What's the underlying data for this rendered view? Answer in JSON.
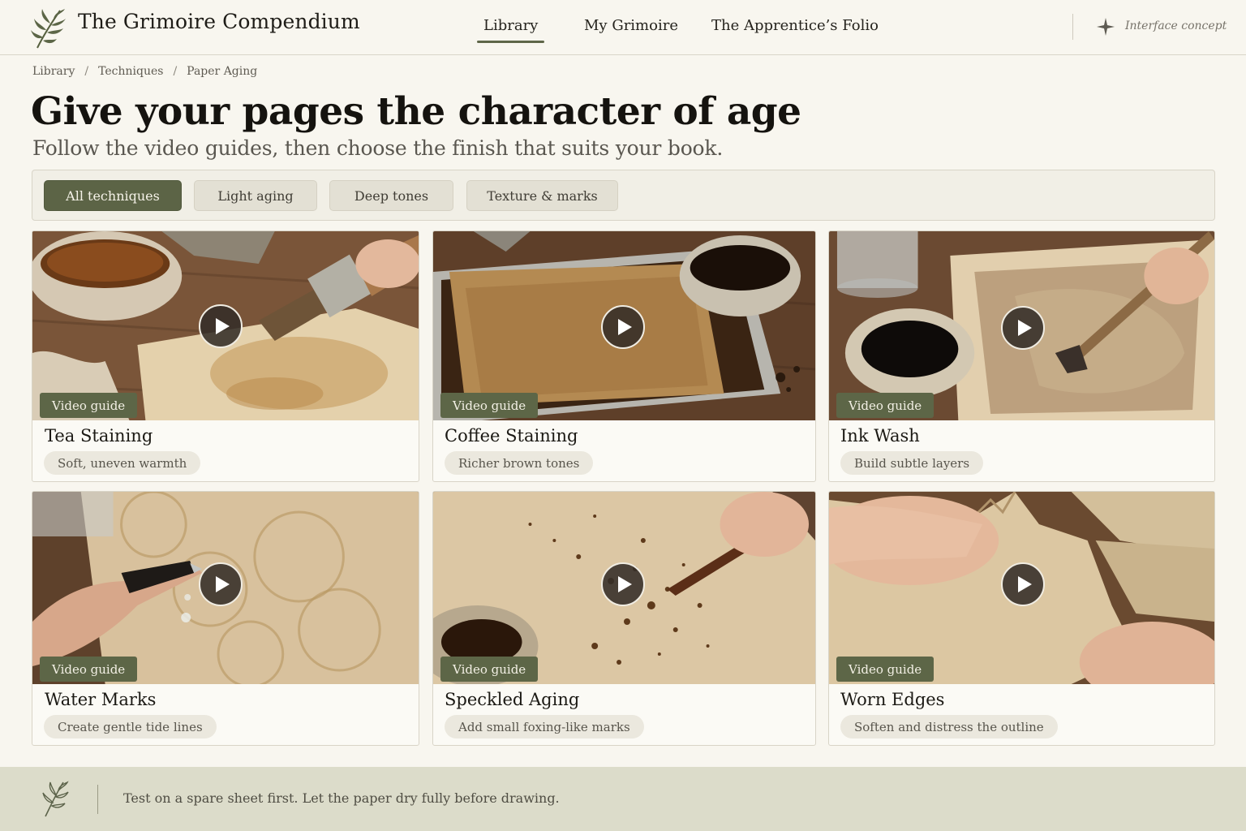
{
  "header": {
    "site_title": "The Grimoire Compendium",
    "nav": [
      {
        "label": "Library",
        "active": true
      },
      {
        "label": "My Grimoire",
        "active": false
      },
      {
        "label": "The Apprentice’s Folio",
        "active": false
      }
    ],
    "concept_label": "Interface concept",
    "logo_icon": "leaf-sprig-icon",
    "concept_icon": "sparkle-icon"
  },
  "breadcrumb": [
    "Library",
    "Techniques",
    "Paper Aging"
  ],
  "page_title": "Give your pages the character of age",
  "subtitle": "Follow the video guides, then choose the finish that suits your book.",
  "filters": [
    {
      "label": "All techniques",
      "active": true
    },
    {
      "label": "Light aging",
      "active": false
    },
    {
      "label": "Deep tones",
      "active": false
    },
    {
      "label": "Texture & marks",
      "active": false
    }
  ],
  "cards": [
    {
      "title": "Tea Staining",
      "tag": "Soft, uneven warmth",
      "badge": "Video guide"
    },
    {
      "title": "Coffee Staining",
      "tag": "Richer brown tones",
      "badge": "Video guide"
    },
    {
      "title": "Ink Wash",
      "tag": "Build subtle layers",
      "badge": "Video guide"
    },
    {
      "title": "Water Marks",
      "tag": "Create gentle tide lines",
      "badge": "Video guide"
    },
    {
      "title": "Speckled Aging",
      "tag": "Add small foxing-like marks",
      "badge": "Video guide"
    },
    {
      "title": "Worn Edges",
      "tag": "Soften and distress the outline",
      "badge": "Video guide"
    }
  ],
  "tip": {
    "text": "Test on a spare sheet first. Let the paper dry fully before drawing.",
    "icon": "leaf-sprig-icon"
  },
  "colors": {
    "accent": "#5c6446",
    "background": "#f8f6ef",
    "tip_bar": "#dcdcca"
  }
}
